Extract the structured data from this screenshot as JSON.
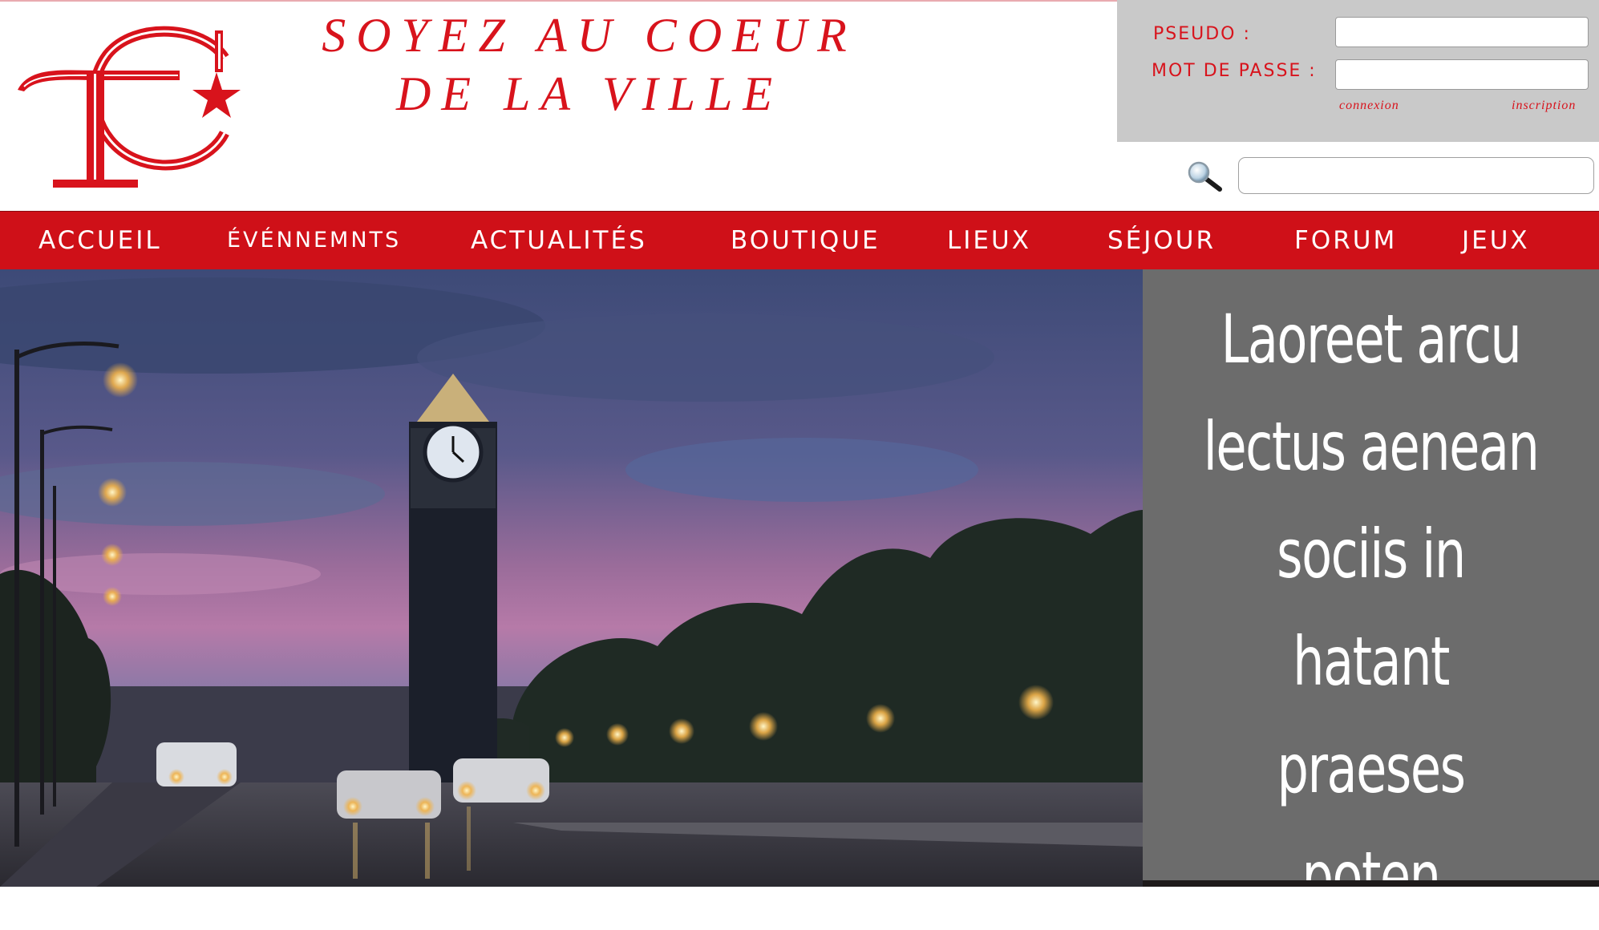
{
  "header": {
    "slogan": "SOYEZ AU COEUR DE LA VILLE",
    "logo_letters": "TC"
  },
  "login": {
    "pseudo_label": "PSEUDO :",
    "password_label": "MOT DE PASSE :",
    "pseudo_value": "",
    "password_value": "",
    "connexion_label": "connexion",
    "inscription_label": "inscription"
  },
  "search": {
    "value": "",
    "icon": "search-icon"
  },
  "nav": {
    "items": [
      {
        "label": "ACCUEIL"
      },
      {
        "label": "ÉVÉNNEMNTS"
      },
      {
        "label": "ACTUALITÉS"
      },
      {
        "label": "BOUTIQUE"
      },
      {
        "label": "LIEUX"
      },
      {
        "label": "SÉJOUR"
      },
      {
        "label": "FORUM"
      },
      {
        "label": "JEUX"
      }
    ]
  },
  "hero": {
    "lines": [
      "Laoreet arcu",
      "lectus aenean",
      "sociis in hatant",
      "praeses",
      "poten"
    ]
  },
  "colors": {
    "brand_red": "#d8131c",
    "nav_red": "#cf1018",
    "login_bg": "#c9c9c9",
    "panel_gray": "#6c6c6c"
  }
}
